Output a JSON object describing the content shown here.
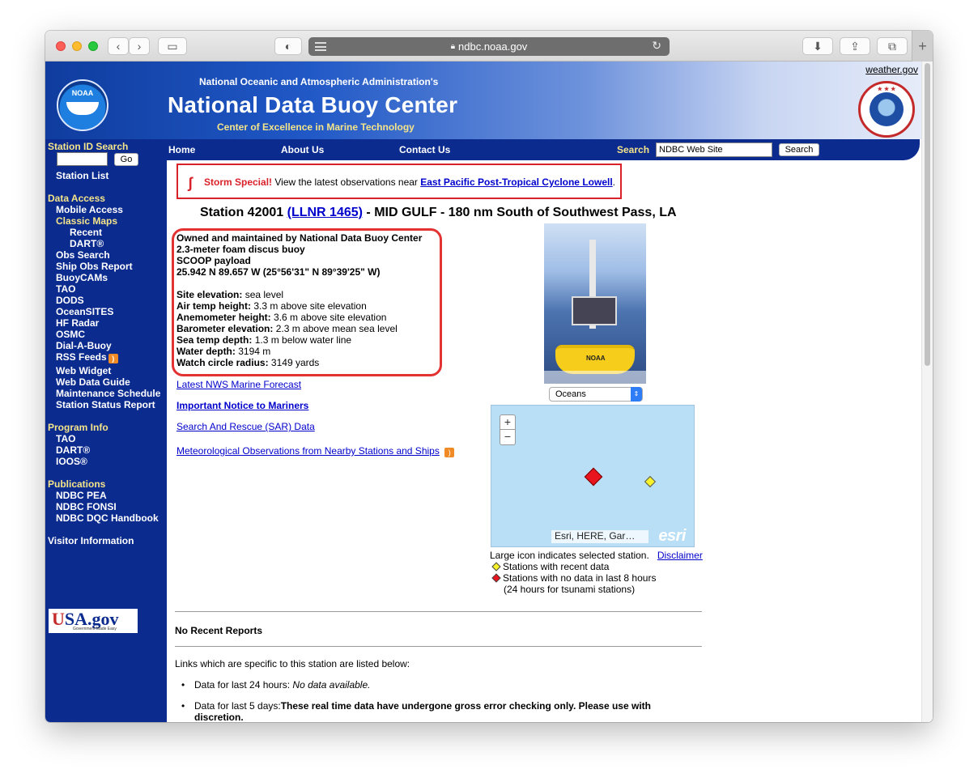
{
  "browser": {
    "url": "ndbc.noaa.gov",
    "new_tab_label": "+"
  },
  "banner": {
    "noaa_logo_text": "NOAA",
    "agency": "National Oceanic and Atmospheric Administration's",
    "title": "National Data Buoy Center",
    "tagline": "Center of Excellence in Marine Technology",
    "weather_link": "weather.gov"
  },
  "nav": {
    "home": "Home",
    "about": "About Us",
    "contact": "Contact Us",
    "search_label": "Search",
    "search_value": "NDBC Web Site",
    "search_button": "Search"
  },
  "sidebar": {
    "station_search_head": "Station ID Search",
    "go": "Go",
    "station_list": "Station List",
    "data_access_head": "Data Access",
    "mobile_access": "Mobile Access",
    "classic_maps": "Classic Maps",
    "recent": "Recent",
    "dart": "DART®",
    "obs_search": "Obs Search",
    "ship_obs": "Ship Obs Report",
    "buoycams": "BuoyCAMs",
    "tao": "TAO",
    "dods": "DODS",
    "oceansites": "OceanSITES",
    "hf_radar": "HF Radar",
    "osmc": "OSMC",
    "dial_a_buoy": "Dial-A-Buoy",
    "rss_feeds": "RSS Feeds",
    "web_widget": "Web Widget",
    "web_data_guide": "Web Data Guide",
    "maintenance": "Maintenance Schedule",
    "station_status": "Station Status Report",
    "program_info_head": "Program Info",
    "p_tao": "TAO",
    "p_dart": "DART®",
    "p_ioos": "IOOS®",
    "publications_head": "Publications",
    "ndbc_pea": "NDBC PEA",
    "ndbc_fonsi": "NDBC FONSI",
    "ndbc_dqc": "NDBC DQC Handbook",
    "visitor_info": "Visitor Information",
    "usagov": "USA.gov",
    "usagov_small": "Government Made Easy"
  },
  "storm": {
    "title": "Storm Special!",
    "text": " View the latest observations near ",
    "link": "East Pacific Post-Tropical Cyclone Lowell",
    "end": "."
  },
  "station": {
    "prefix": "Station 42001 ",
    "llnr_link": "(LLNR 1465)",
    "suffix": " - MID GULF - 180 nm South of Southwest Pass, LA",
    "owner": "Owned and maintained by National Data Buoy Center",
    "hull": "2.3-meter foam discus buoy",
    "payload": "SCOOP payload",
    "position": "25.942 N 89.657 W (25°56'31\" N 89°39'25\" W)",
    "details": [
      {
        "label": "Site elevation:",
        "value": " sea level"
      },
      {
        "label": "Air temp height:",
        "value": " 3.3 m above site elevation"
      },
      {
        "label": "Anemometer height:",
        "value": " 3.6 m above site elevation"
      },
      {
        "label": "Barometer elevation:",
        "value": " 2.3 m above mean sea level"
      },
      {
        "label": "Sea temp depth:",
        "value": " 1.3 m below water line"
      },
      {
        "label": "Water depth:",
        "value": " 3194 m"
      },
      {
        "label": "Watch circle radius:",
        "value": " 3149 yards"
      }
    ],
    "buoy_label": "NOAA"
  },
  "links": {
    "forecast": "Latest NWS Marine Forecast",
    "notice": "Important Notice to Mariners",
    "sar": "Search And Rescue (SAR) Data",
    "met_obs": "Meteorological Observations from Nearby Stations and Ships"
  },
  "map": {
    "dropdown": "Oceans",
    "zoom_in": "+",
    "zoom_out": "−",
    "attribution": "Esri, HERE, Gar…",
    "esri": "esri",
    "large_icon_note": "Large icon indicates selected station.",
    "disclaimer": "Disclaimer",
    "legend_recent": "Stations with recent data",
    "legend_nodata": "Stations with no data in last 8 hours",
    "legend_tsunami": "(24 hours for tsunami stations)"
  },
  "reports": {
    "no_recent": "No Recent Reports",
    "links_below": "Links which are specific to this station are listed below:",
    "last24_label": "Data for last 24 hours: ",
    "last24_value": "No data available.",
    "last5_label": "Data for last 5 days:",
    "last5_value": "These real time data have undergone gross error checking only. Please use with discretion."
  }
}
